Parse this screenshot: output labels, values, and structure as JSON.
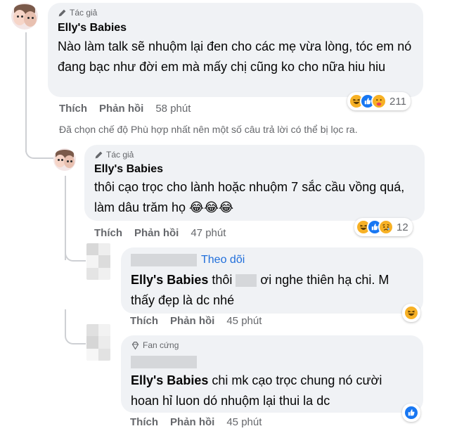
{
  "comments": [
    {
      "badge": "Tác giả",
      "author": "Elly's Babies",
      "text": "Nào làm talk sẽ nhuộm lại đen cho các mẹ vừa lòng, tóc em nó đang bạc như đời em mà mấy chị cũng ko cho nữa hiu hiu",
      "like_label": "Thích",
      "reply_label": "Phản hồi",
      "time": "58 phút",
      "reaction_count": "211",
      "reactions": [
        "haha-icon",
        "like-icon",
        "care-icon"
      ]
    },
    {
      "badge": "Tác giả",
      "author": "Elly's Babies",
      "text": "thôi cạo trọc cho lành hoặc nhuộm 7 sắc cầu vồng quá, làm dâu trăm họ 😂😂😂",
      "like_label": "Thích",
      "reply_label": "Phản hồi",
      "time": "47 phút",
      "reaction_count": "12",
      "reactions": [
        "haha-icon",
        "like-icon",
        "sad-icon"
      ]
    },
    {
      "follow_label": "Theo dõi",
      "mention": "Elly's Babies",
      "text_before": "thôi",
      "text_after": "ơi nghe thiên hạ chi. M thấy đẹp là dc nhé",
      "like_label": "Thích",
      "reply_label": "Phản hồi",
      "time": "45 phút",
      "reactions": [
        "haha-icon"
      ]
    },
    {
      "badge": "Fan cứng",
      "mention": "Elly's Babies",
      "text": "chi mk cạo trọc chung nó cười hoan hỉ luon dó nhuộm lại thui la dc",
      "like_label": "Thích",
      "reply_label": "Phản hồi",
      "time": "45 phút",
      "reactions": [
        "like-icon"
      ]
    }
  ],
  "filter_note": "Đã chọn chế độ Phù hợp nhất nên một số câu trả lời có thể bị lọc ra.",
  "colors": {
    "bubble": "#f0f2f5",
    "secondary_text": "#65676b",
    "link": "#216fdb",
    "like": "#1877f2",
    "haha": "#f7b125"
  }
}
